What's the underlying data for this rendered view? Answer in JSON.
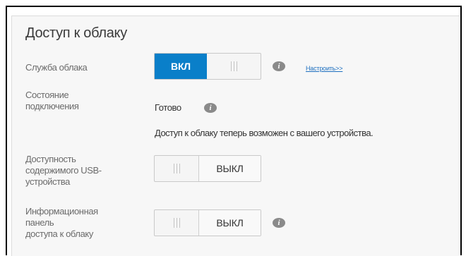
{
  "section": {
    "title": "Доступ к облаку"
  },
  "cloud_service": {
    "label": "Служба облака",
    "toggle_label": "ВКЛ",
    "toggle_state": "on",
    "info_icon": "info-icon",
    "link": "Настроить>>"
  },
  "connection": {
    "label": "Состояние\nподключения",
    "status": "Готово",
    "info_icon": "info-icon",
    "note": "Доступ к облаку теперь возможен с вашего устройства."
  },
  "usb_availability": {
    "label": "Доступность\nсодержимого USB-\nустройства",
    "toggle_label": "ВЫКЛ",
    "toggle_state": "off"
  },
  "dashboard": {
    "label": "Информационная\nпанель\nдоступа к облаку",
    "toggle_label": "ВЫКЛ",
    "toggle_state": "off",
    "info_icon": "info-icon"
  },
  "colors": {
    "accent": "#0a7fc9",
    "panel_bg": "#f7f7f7",
    "link": "#1e6fbf",
    "label_text": "#6b6b6b"
  }
}
